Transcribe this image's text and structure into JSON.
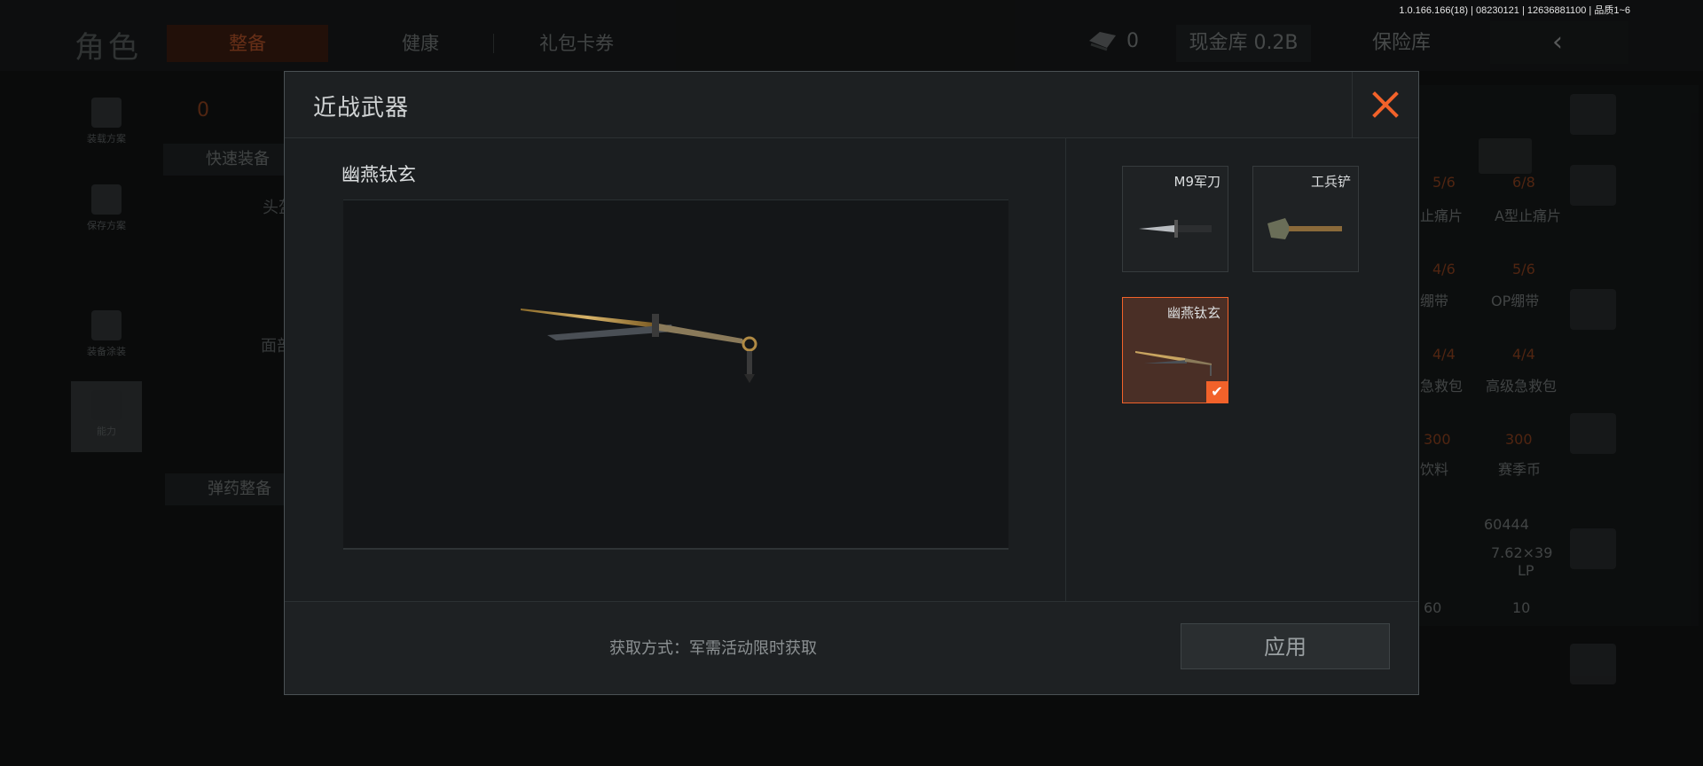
{
  "version_text": "1.0.166.166(18) | 08230121 | 12636881100 | 品质1~6",
  "header": {
    "title": "角色",
    "tabs": [
      "整备",
      "健康",
      "礼包卡券"
    ],
    "cash_count": "0",
    "vault_label": "现金库 0.2B",
    "insurance_label": "保险库",
    "back_icon": "chevron-left-icon"
  },
  "left_rail": {
    "items": [
      {
        "label": "装载方案",
        "icon": "vest-icon"
      },
      {
        "label": "保存方案",
        "icon": "download-icon"
      },
      {
        "label": "装备涂装",
        "icon": "helmet-icon"
      },
      {
        "label": "能力",
        "icon": "lightning-hex-icon"
      }
    ],
    "quick_equip": "快速装备",
    "ammo_equip": "弹药整备",
    "slot_head": "头盔",
    "slot_face": "面部",
    "counter": "0"
  },
  "inventory": {
    "items": [
      {
        "name": "止痛片",
        "count": "5/6"
      },
      {
        "name": "A型止痛片",
        "count": "6/8"
      },
      {
        "name": "绷带",
        "count": "4/6"
      },
      {
        "name": "OP绷带",
        "count": "5/6"
      },
      {
        "name": "急救包",
        "count": "4/4"
      },
      {
        "name": "高级急救包",
        "count": "4/4"
      },
      {
        "name": "饮料",
        "count": "300"
      },
      {
        "name": "赛季币",
        "count": "300"
      },
      {
        "name": "60444",
        "count": ""
      },
      {
        "name": "7.62×39",
        "count": ""
      },
      {
        "name": "LP",
        "count": "10"
      },
      {
        "name": "60",
        "count": ""
      }
    ]
  },
  "modal": {
    "title": "近战武器",
    "close_icon": "close-icon",
    "selected_name": "幽燕钛玄",
    "weapons": [
      {
        "name": "M9军刀",
        "icon": "bayonet-icon",
        "selected": false
      },
      {
        "name": "工兵铲",
        "icon": "shovel-icon",
        "selected": false
      },
      {
        "name": "幽燕钛玄",
        "icon": "gilded-glaive-icon",
        "selected": true
      }
    ],
    "acquire_text": "获取方式：军需活动限时获取",
    "apply_label": "应用"
  },
  "colors": {
    "accent": "#f2622a",
    "panel": "#1b1e20",
    "background": "#0a0b0b"
  }
}
